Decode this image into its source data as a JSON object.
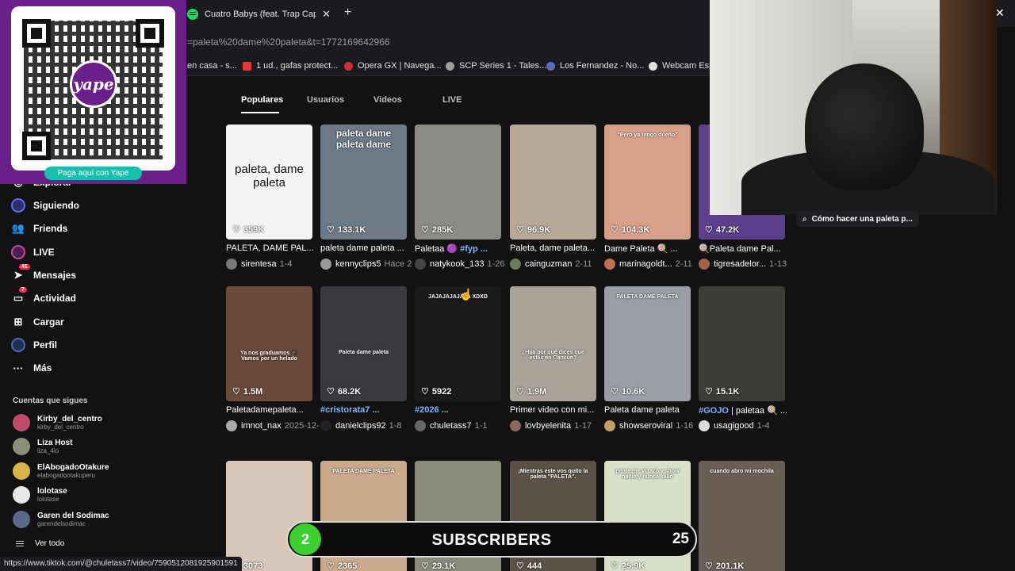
{
  "browser": {
    "tab_title": "Cuatro Babys (feat. Trap Capos, Nokles)",
    "tab_close": "✕",
    "new_tab": "+",
    "url": "=paleta%20dame%20paleta&t=1772169642966",
    "bookmarks": [
      {
        "label": "en casa - s...",
        "color": "#3a3a3a"
      },
      {
        "label": "1 ud., gafas protect...",
        "color": "#e53935"
      },
      {
        "label": "Opera GX | Navega...",
        "color": "#d32f2f"
      },
      {
        "label": "SCP Series 1 - Tales...",
        "color": "#9e9e9e"
      },
      {
        "label": "Los Fernandez - No...",
        "color": "#5c6bc0"
      },
      {
        "label": "Webcam Espe",
        "color": "#e0e0e0"
      }
    ],
    "status_url": "https://www.tiktok.com/@chuletass7/video/7590512081925901591"
  },
  "qr": {
    "logo_text": "yape",
    "button": "Paga aquí con Yape"
  },
  "sidebar": {
    "items": [
      {
        "label": "Explorar",
        "icon": "compass-icon"
      },
      {
        "label": "Siguiendo",
        "icon": "following-icon"
      },
      {
        "label": "Friends",
        "icon": "friends-icon"
      },
      {
        "label": "LIVE",
        "icon": "live-icon"
      },
      {
        "label": "Mensajes",
        "icon": "messages-icon",
        "badge": "41"
      },
      {
        "label": "Actividad",
        "icon": "activity-icon",
        "badge": "7"
      },
      {
        "label": "Cargar",
        "icon": "upload-icon"
      },
      {
        "label": "Perfil",
        "icon": "profile-icon"
      },
      {
        "label": "Más",
        "icon": "more-icon"
      }
    ],
    "following_header": "Cuentas que sigues",
    "following": [
      {
        "name": "Kirby_del_centro",
        "handle": "kirby_del_centro",
        "color": "#c04a6a"
      },
      {
        "name": "Liza Host",
        "handle": "liza_4io",
        "color": "#8a8f7a"
      },
      {
        "name": "ElAbogadoOtakure",
        "handle": "elabogadootakuperu",
        "color": "#d9b44a"
      },
      {
        "name": "lolotase",
        "handle": "lolotase",
        "color": "#e8e8e8"
      },
      {
        "name": "Garen del Sodimac",
        "handle": "garendelsodimac",
        "color": "#5a6a8a"
      }
    ],
    "see_all": "Ver todo"
  },
  "content_tabs": [
    "Populares",
    "Usuarios",
    "Videos",
    "LIVE"
  ],
  "suggestion": "Cómo hacer una paleta p...",
  "videos": [
    {
      "likes": "359K",
      "desc": "PALETA, DAME PAL...",
      "tag": "",
      "user": "sirentesa",
      "date": "1-4",
      "caption": "paleta, dame paleta",
      "bg": "#f4f4f4",
      "avatar": "#777"
    },
    {
      "likes": "133.1K",
      "desc": "paleta dame paleta ...",
      "tag": "",
      "user": "kennyclips5",
      "date": "Hace 2",
      "caption": "paleta dame paleta dame",
      "bg": "#6d7a86",
      "avatar": "#999"
    },
    {
      "likes": "285K",
      "desc": "Paletaa 🟣 ",
      "tag": "#fyp ...",
      "user": "natykook_133",
      "date": "1-26",
      "caption": "",
      "bg": "#8c8a84",
      "avatar": "#444"
    },
    {
      "likes": "96.9K",
      "desc": "Paleta, dame paleta...",
      "tag": "",
      "user": "cainguzman",
      "date": "2-11",
      "caption": "",
      "bg": "#b8a996",
      "avatar": "#6a7a5a"
    },
    {
      "likes": "104.3K",
      "desc": "Dame Paleta 🍭 ...",
      "tag": "",
      "user": "marinagoldt...",
      "date": "2-11",
      "caption": "\"Pero ya tengo dueño\"",
      "bg": "#d9a089",
      "avatar": "#c07050"
    },
    {
      "likes": "47.2K",
      "desc": "🍭Paleta dame Pal...",
      "tag": "",
      "user": "tigresadelor...",
      "date": "1-13",
      "caption": "",
      "bg": "#5e3f8e",
      "avatar": "#a0604a"
    },
    {
      "likes": "1.5M",
      "desc": "Paletadamepaleta...",
      "tag": "",
      "user": "imnot_nax",
      "date": "2025-12-",
      "caption": "Ya nos graduamos 🎓 Vamos por un helado",
      "bg": "#6a4a3a",
      "avatar": "#aaa"
    },
    {
      "likes": "68.2K",
      "desc": "",
      "tag": "#cristorata7 ...",
      "user": "danielclips92",
      "date": "1-8",
      "caption": "Paleta dame paleta",
      "bg": "#3a3b40",
      "avatar": "#222"
    },
    {
      "likes": "5922",
      "desc": "",
      "tag": "#2026 ...",
      "user": "chuletass7",
      "date": "1-1",
      "caption": "JAJAJAJAJAJA XDXD",
      "bg": "#1a1a1c",
      "avatar": "#666"
    },
    {
      "likes": "1.9M",
      "desc": "Primer video con mi...",
      "tag": "",
      "user": "lovbyelenita",
      "date": "1-17",
      "caption": "¿Hija por qué dices que estás en Cancún?",
      "bg": "#a9a39a",
      "avatar": "#8a6a5a"
    },
    {
      "likes": "10.6K",
      "desc": "Paleta dame paleta",
      "tag": "",
      "user": "showseroviral",
      "date": "1-16",
      "caption": "PALETA DAME PALETA",
      "bg": "#9a9ea4",
      "avatar": "#c0a060"
    },
    {
      "likes": "15.1K",
      "desc": " | paletaa 🍭 ...",
      "tag": "#GOJO",
      "user": "usagigood",
      "date": "1-4",
      "caption": "",
      "bg": "#3a3e36",
      "avatar": "#ddd"
    },
    {
      "likes": "3073",
      "desc": "",
      "tag": "",
      "user": "",
      "date": "",
      "caption": "",
      "bg": "#d8c6b8",
      "avatar": "#666"
    },
    {
      "likes": "2365",
      "desc": "",
      "tag": "",
      "user": "",
      "date": "",
      "caption": "PALETA DAME PALETA",
      "bg": "#c9a98a",
      "avatar": "#666"
    },
    {
      "likes": "29.1K",
      "desc": "",
      "tag": "",
      "user": "",
      "date": "",
      "caption": "",
      "bg": "#8a8a7a",
      "avatar": "#666"
    },
    {
      "likes": "444",
      "desc": "",
      "tag": "",
      "user": "",
      "date": "",
      "caption": "¡Mientras este vos quito la paleta \"PALETA\".",
      "bg": "#5a5248",
      "avatar": "#666"
    },
    {
      "likes": "25.9K",
      "desc": "",
      "tag": "",
      "user": "",
      "date": "",
      "caption": "gente me vi tazo y show nadie y nunca salió",
      "bg": "#d9e0c8",
      "avatar": "#666"
    },
    {
      "likes": "201.1K",
      "desc": "",
      "tag": "",
      "user": "",
      "date": "",
      "caption": "cuando abro mi mochila",
      "bg": "#6a5f55",
      "avatar": "#666"
    }
  ],
  "overlay": {
    "left_number": "2",
    "label": "SUBSCRIBERS",
    "right_number": "25"
  },
  "window_close": "✕"
}
